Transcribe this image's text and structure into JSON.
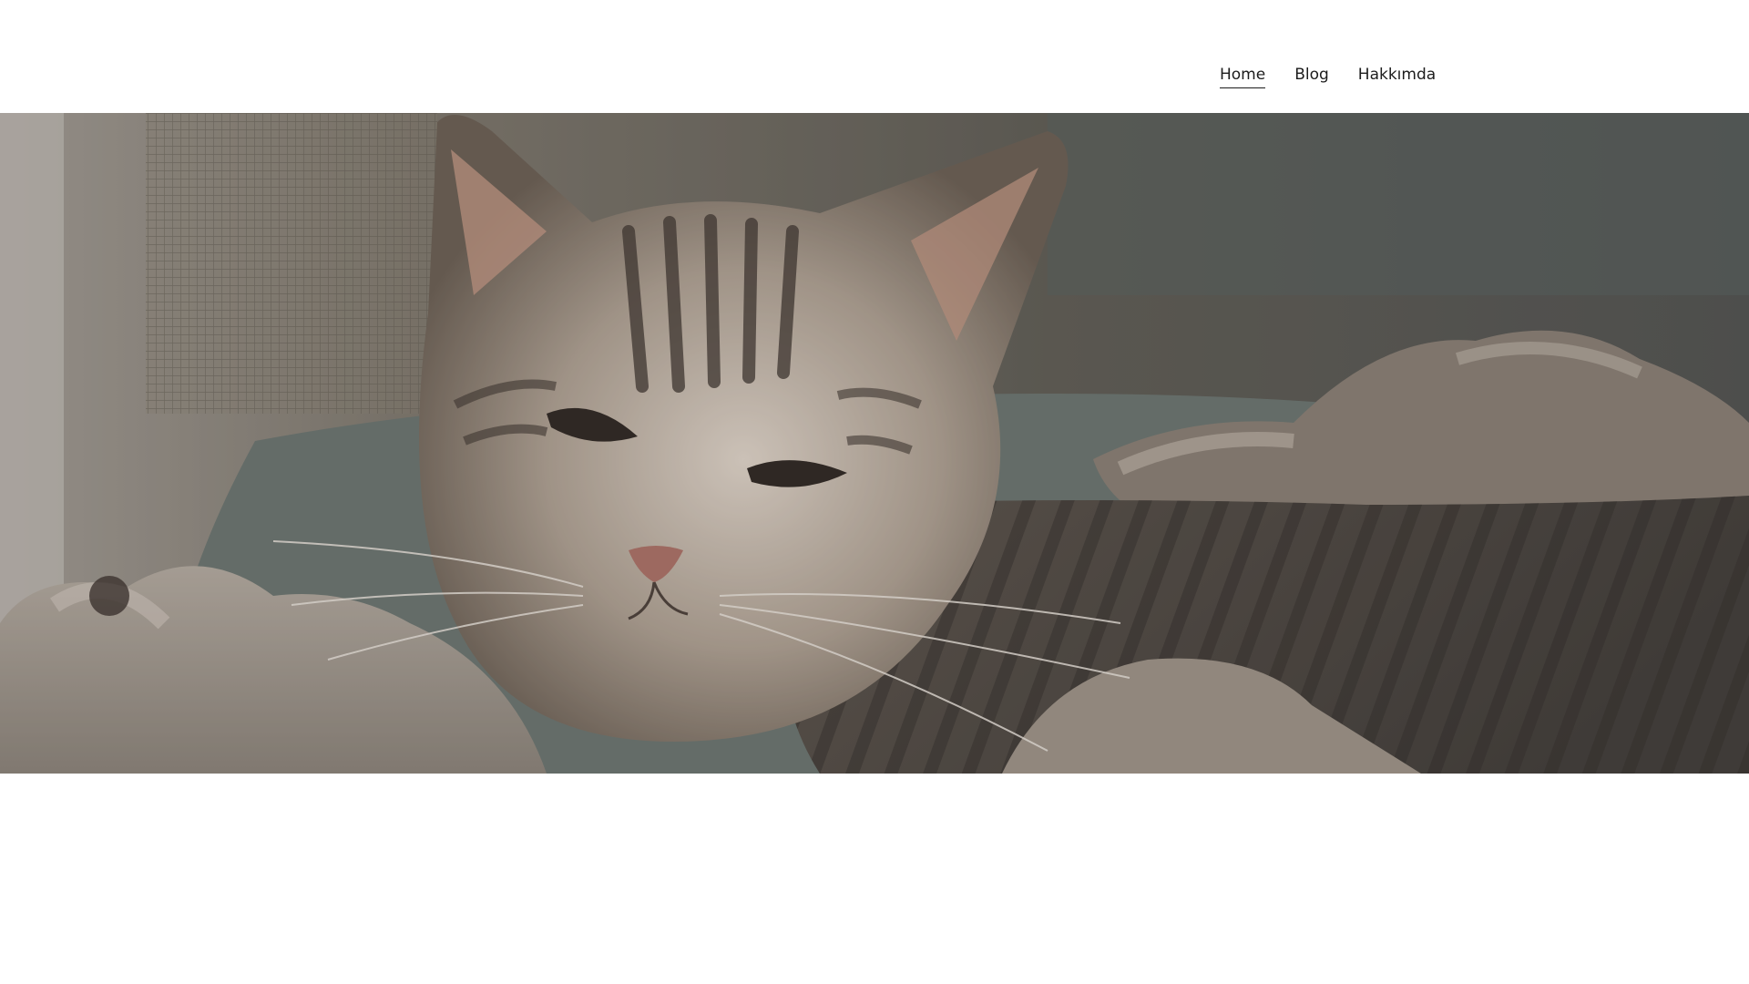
{
  "nav": {
    "items": [
      {
        "label": "Home",
        "active": true
      },
      {
        "label": "Blog",
        "active": false
      },
      {
        "label": "Hakkımda",
        "active": false
      }
    ]
  },
  "hero": {
    "image_subject": "tabby-cat-in-hammock",
    "overlay_color": "#46403c"
  }
}
